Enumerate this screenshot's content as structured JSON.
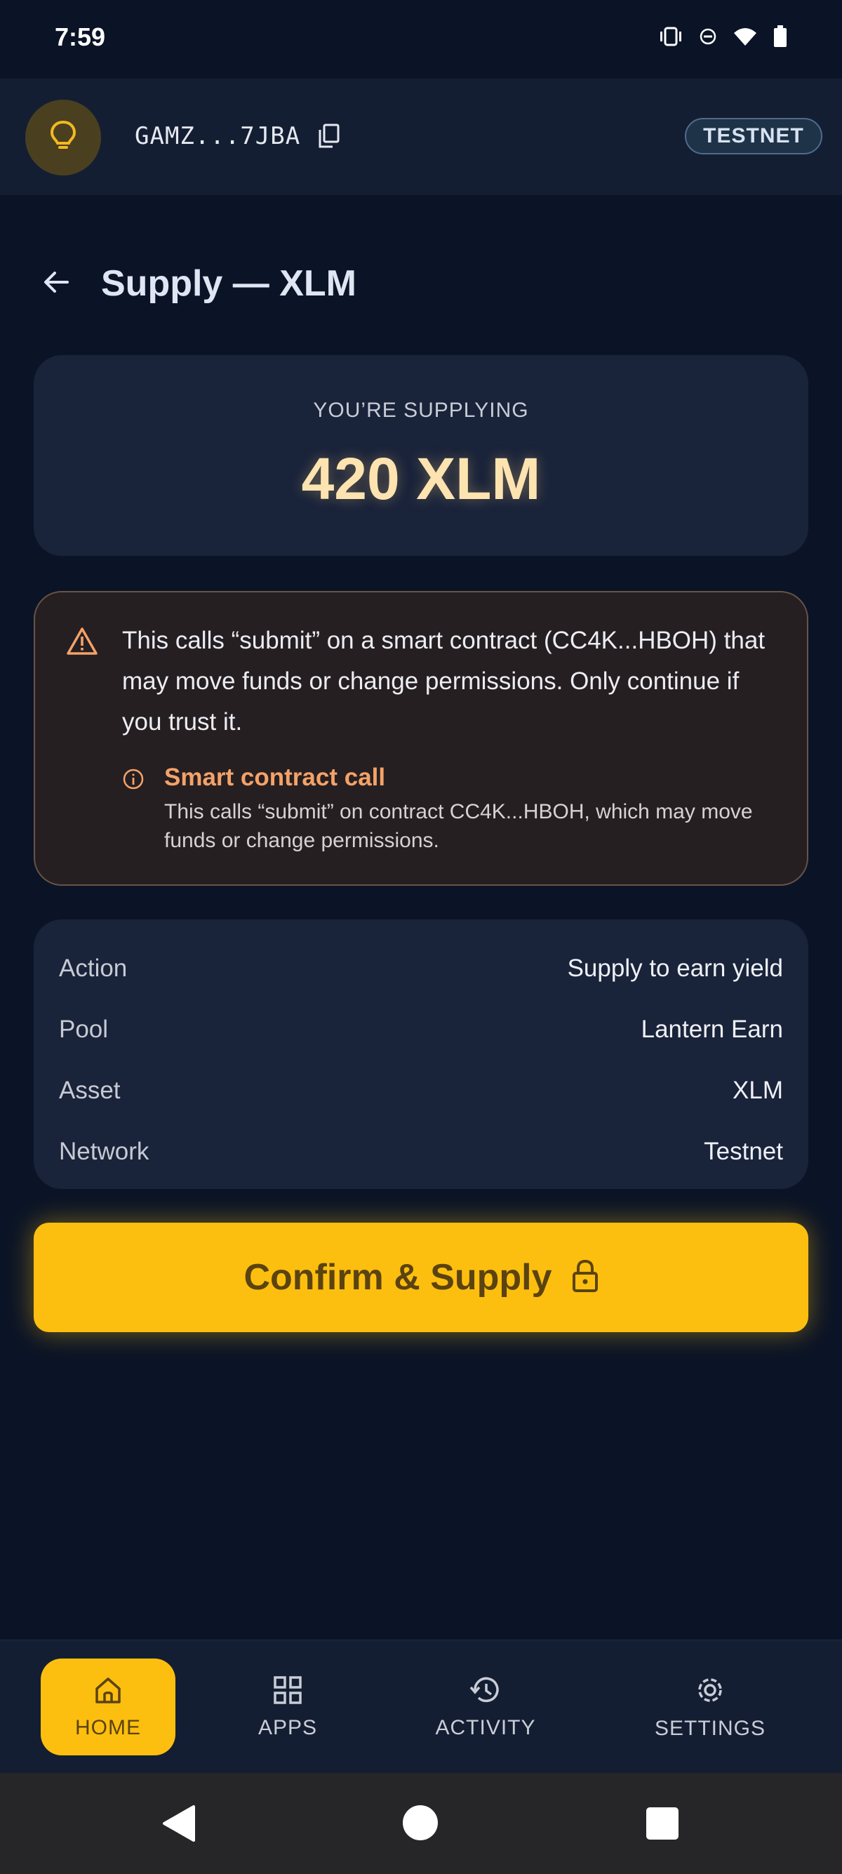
{
  "status_bar": {
    "time": "7:59",
    "icons": [
      "vibrate-icon",
      "do-not-disturb-icon",
      "wifi-icon",
      "battery-icon"
    ]
  },
  "wallet": {
    "avatar_icon": "lightbulb-icon",
    "address": "GAMZ...7JBA",
    "copy_icon": "copy-icon",
    "network": "TESTNET"
  },
  "page": {
    "title": "Supply — XLM"
  },
  "amount": {
    "label": "YOU’RE SUPPLYING",
    "value": "420 XLM"
  },
  "warning": {
    "text": "This calls “submit” on a smart contract (CC4K...HBOH) that may move funds or change permissions. Only continue if you trust it.",
    "detail_title": "Smart contract call",
    "detail_text": "This calls “submit” on contract CC4K...HBOH, which may move funds or change permissions."
  },
  "details": {
    "rows": [
      {
        "label": "Action",
        "value": "Supply to earn yield"
      },
      {
        "label": "Pool",
        "value": "Lantern Earn"
      },
      {
        "label": "Asset",
        "value": "XLM"
      },
      {
        "label": "Network",
        "value": "Testnet"
      }
    ]
  },
  "confirm": {
    "label": "Confirm & Supply",
    "icon": "lock-icon"
  },
  "nav": {
    "items": [
      {
        "label": "HOME",
        "icon": "home-icon",
        "active": true
      },
      {
        "label": "APPS",
        "icon": "grid-icon",
        "active": false
      },
      {
        "label": "ACTIVITY",
        "icon": "history-icon",
        "active": false
      },
      {
        "label": "SETTINGS",
        "icon": "gear-icon",
        "active": false
      }
    ]
  },
  "colors": {
    "background": "#0b1426",
    "card": "#19233a",
    "accent": "#fdbf0f",
    "warning_border": "#6a5346",
    "warning_title": "#f4a268"
  }
}
